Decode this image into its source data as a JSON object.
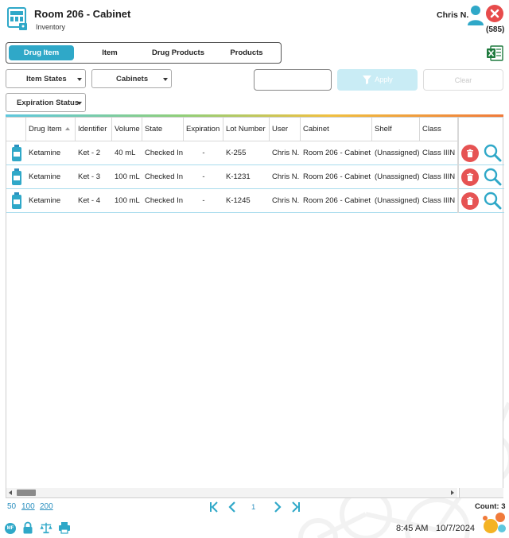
{
  "header": {
    "title": "Room 206 - Cabinet",
    "subtitle": "Inventory",
    "user_name": "Chris N.",
    "user_count": "(585)"
  },
  "tabs": [
    {
      "label": "Drug Item",
      "active": true
    },
    {
      "label": "Item",
      "active": false
    },
    {
      "label": "Drug Products",
      "active": false
    },
    {
      "label": "Products",
      "active": false
    }
  ],
  "filters": {
    "item_states": "Item States",
    "cabinets": "Cabinets",
    "expiration_status": "Expiration Status",
    "search_value": "",
    "apply_label": "Apply",
    "clear_label": "Clear"
  },
  "table": {
    "columns": [
      "Drug Item",
      "Identifier",
      "Volume",
      "State",
      "Expiration",
      "Lot Number",
      "User",
      "Cabinet",
      "Shelf",
      "Class"
    ],
    "rows": [
      [
        "Ketamine",
        "Ket - 2",
        "40 mL",
        "Checked In",
        "-",
        "K-255",
        "Chris N.",
        "Room 206 - Cabinet",
        "(Unassigned)",
        "Class IIIN"
      ],
      [
        "Ketamine",
        "Ket - 3",
        "100 mL",
        "Checked In",
        "-",
        "K-1231",
        "Chris N.",
        "Room 206 - Cabinet",
        "(Unassigned)",
        "Class IIIN"
      ],
      [
        "Ketamine",
        "Ket - 4",
        "100 mL",
        "Checked In",
        "-",
        "K-1245",
        "Chris N.",
        "Room 206 - Cabinet",
        "(Unassigned)",
        "Class IIIN"
      ]
    ]
  },
  "footer": {
    "page_sizes": [
      "50",
      "100",
      "200"
    ],
    "current_page": "1",
    "count": "Count: 3",
    "time": "8:45 AM",
    "date": "10/7/2024",
    "mf_badge": "MF"
  },
  "colors": {
    "accent": "#2fa8c8",
    "danger": "#e65353",
    "excel": "#1f7a3e"
  },
  "icons": [
    "cabinet-icon",
    "user-icon",
    "close-icon",
    "excel-icon",
    "vial-icon",
    "trash-icon",
    "search-icon",
    "lock-icon",
    "scale-icon",
    "printer-icon"
  ]
}
